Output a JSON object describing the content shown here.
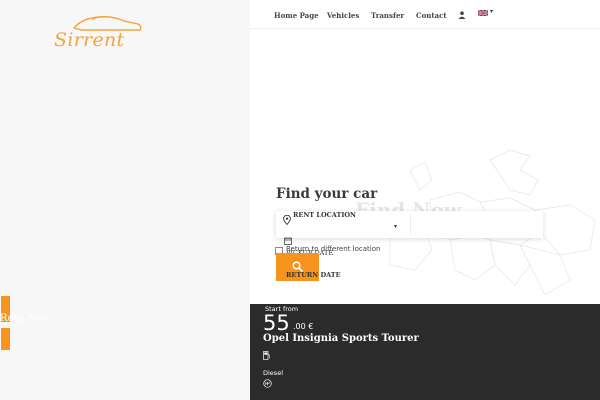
{
  "brand": {
    "logo_text": "Sirrent"
  },
  "nav": {
    "items": [
      {
        "label": "Home Page"
      },
      {
        "label": "Vehicles"
      },
      {
        "label": "Transfer"
      },
      {
        "label": "Contact"
      }
    ],
    "user_icon": "user-icon",
    "language_flag": "uk-flag-icon"
  },
  "search": {
    "heading": "Find your car",
    "watermark": "Find Now",
    "rent_location_label": "RENT LOCATION",
    "rent_location_value": "",
    "pickup_label": "PICKUP DATE",
    "different_location_label": "Return to different location",
    "different_location_checked": false,
    "return_label": "RETURN DATE",
    "search_icon": "search-icon"
  },
  "sidebar": {
    "label": "Rent Now"
  },
  "offer": {
    "start_from": "Start from",
    "price_int": "55",
    "price_dec": ".00 €",
    "car_name": "Opel Insignia Sports Tourer",
    "fuel": "Diesel"
  },
  "colors": {
    "accent": "#f7941d",
    "dark_band": "#2b2b2b",
    "logo": "#f5a43a"
  }
}
